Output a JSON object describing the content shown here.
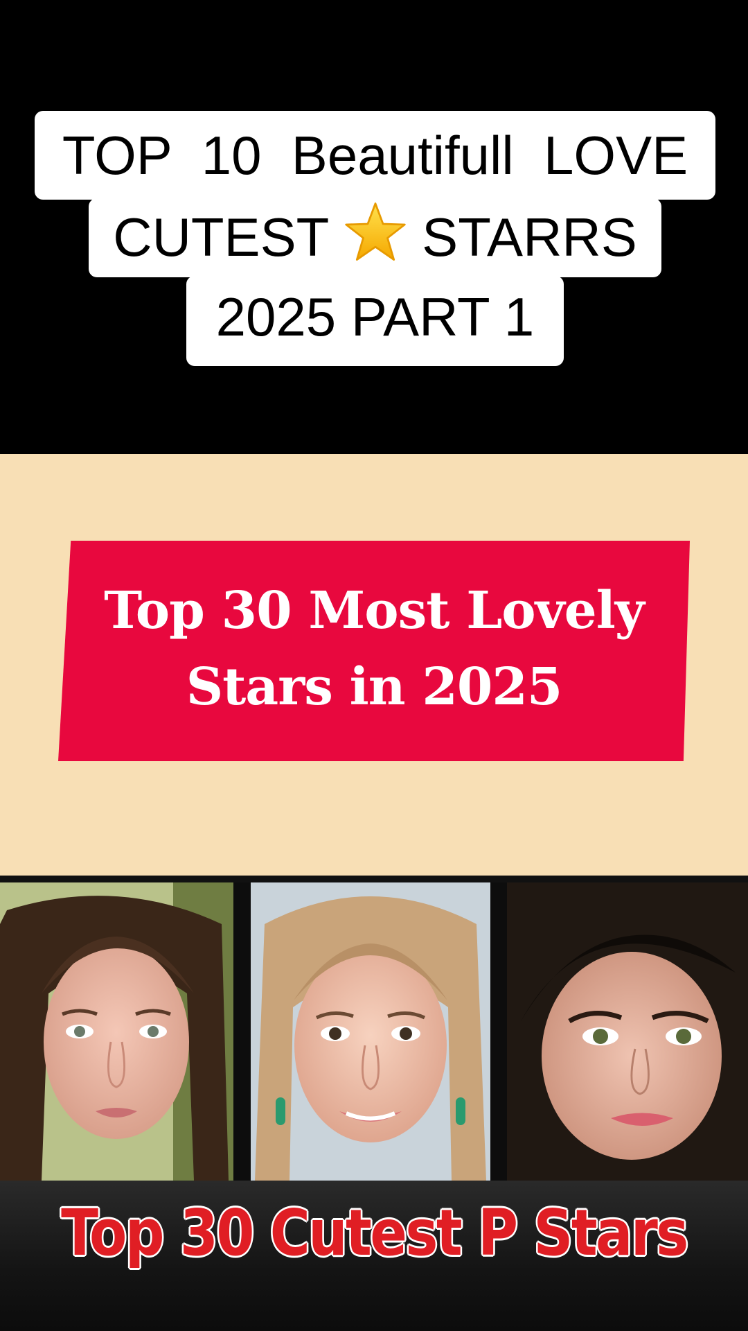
{
  "caption": {
    "line1": "TOP  10  Beautifull  LOVE",
    "line2_pre": "CUTEST ",
    "line2_icon": "star-icon",
    "line2_post": " STARRS",
    "line3": "2025 PART 1"
  },
  "banner": {
    "line1": "Top 30 Most Lovely",
    "line2": "Stars in 2025"
  },
  "photos": [
    {
      "name": "portrait-dark-hair"
    },
    {
      "name": "portrait-blonde-hair"
    },
    {
      "name": "portrait-black-hair"
    }
  ],
  "bottom": {
    "title": "Top 30 Cutest P Stars"
  },
  "colors": {
    "background": "#000000",
    "caption_bg": "#ffffff",
    "beige": "#f8dfb5",
    "banner_red": "#e8083e",
    "bottom_text_red": "#e01e24"
  }
}
